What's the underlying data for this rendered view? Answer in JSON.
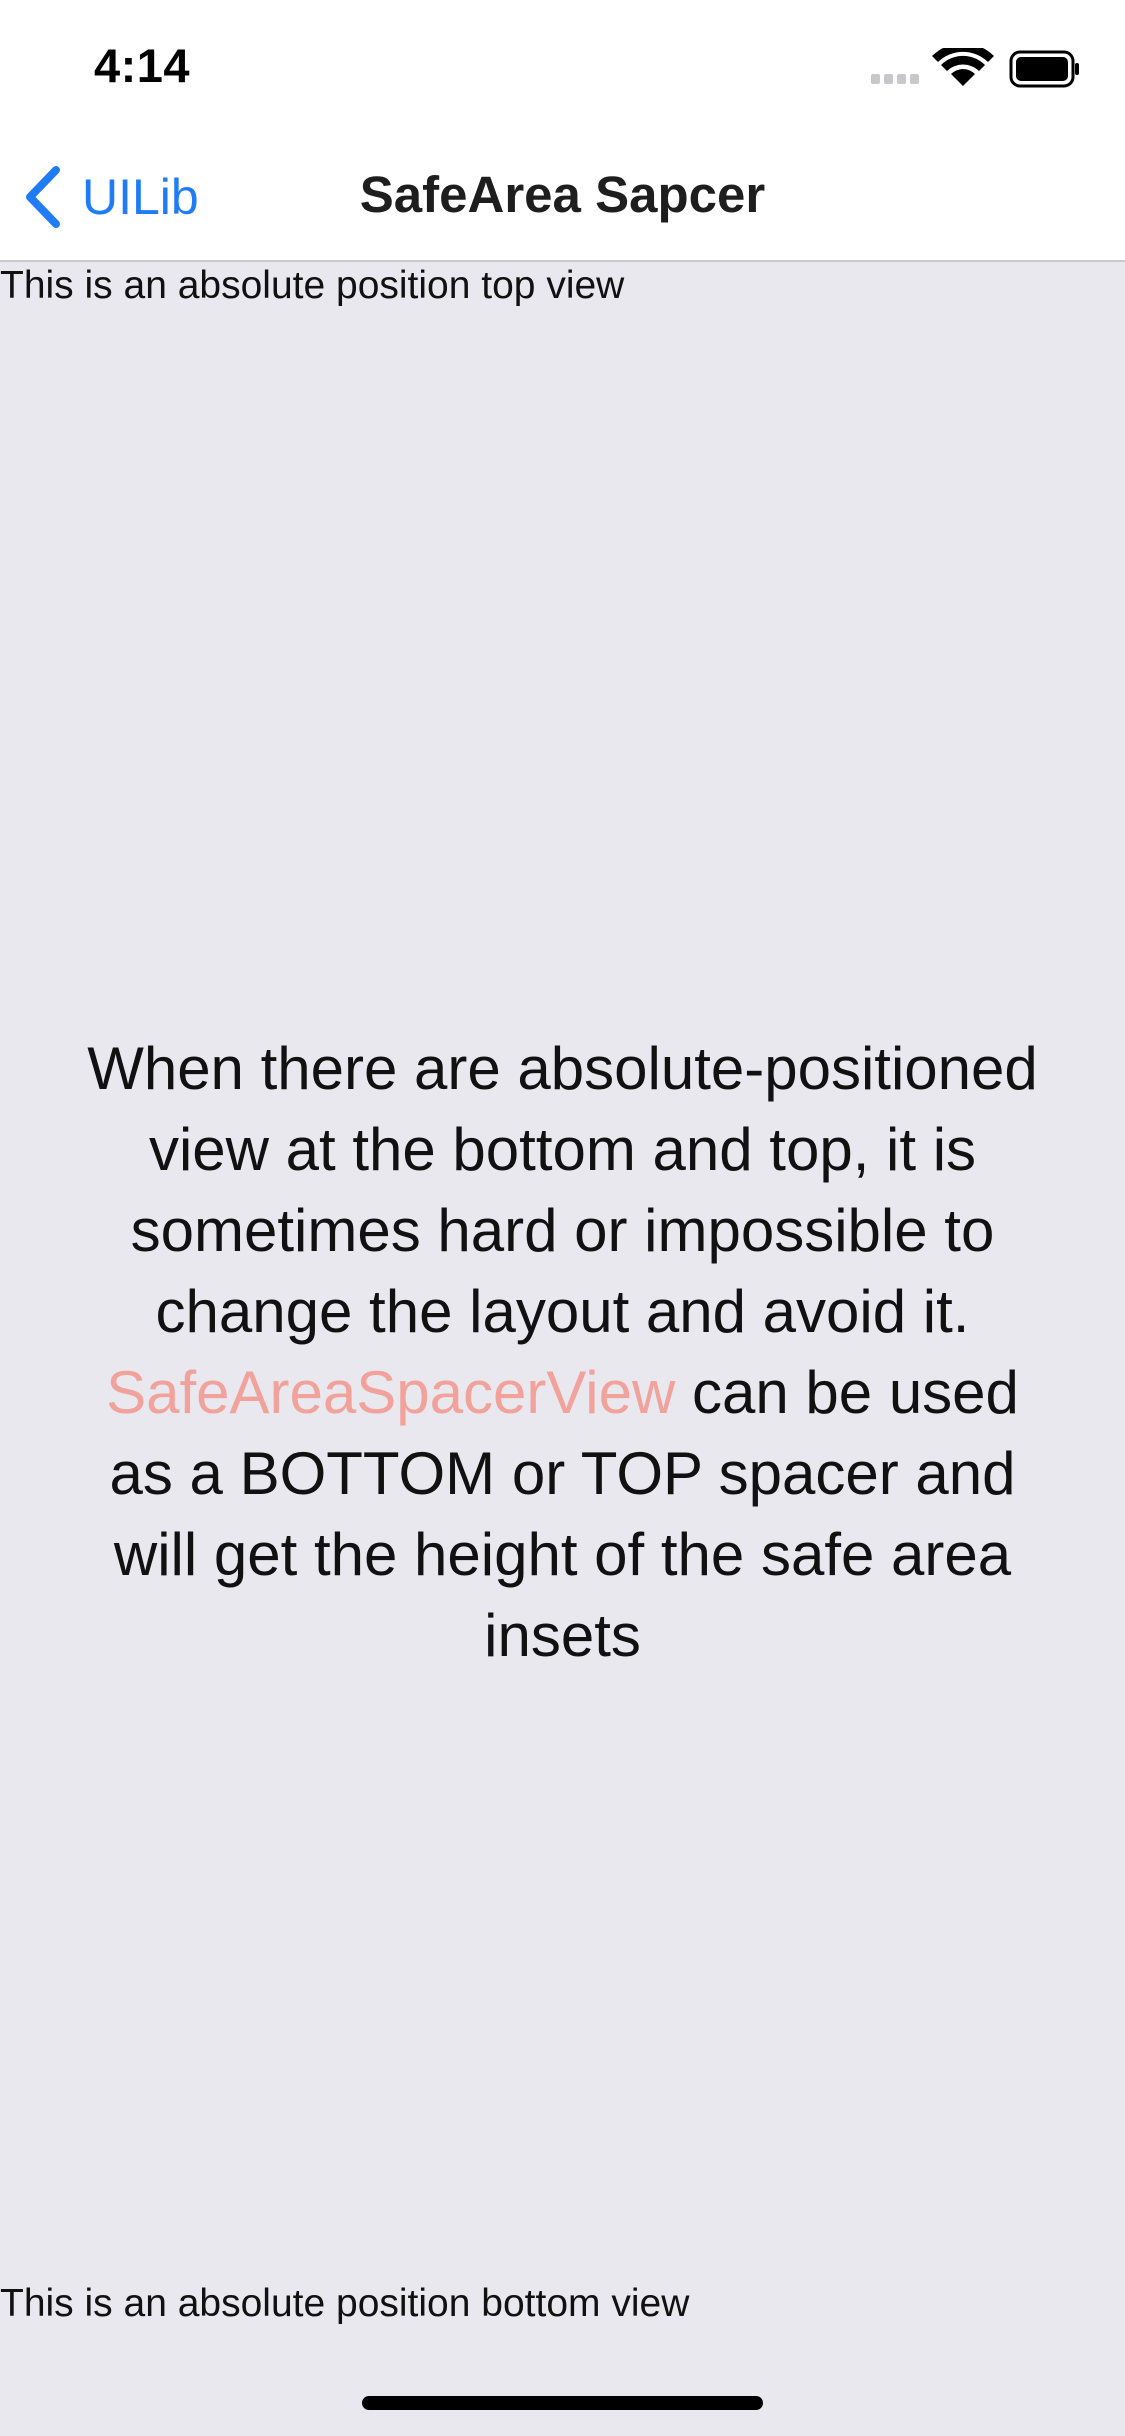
{
  "status_bar": {
    "time": "4:14",
    "icons": [
      "cellular-signal-icon",
      "wifi-icon",
      "battery-icon"
    ]
  },
  "nav_bar": {
    "back_label": "UILib",
    "title": "SafeArea Sapcer"
  },
  "content": {
    "top_view_text": "This is an absolute position top view",
    "explanation_before": "When there are absolute-positioned view at the bottom and top, it is sometimes hard or impossible to change the layout and avoid it. ",
    "explanation_highlight": "SafeAreaSpacerView",
    "explanation_after": " can be used as a BOTTOM or TOP spacer and will get the height of the safe area insets",
    "bottom_view_text": "This is an absolute position bottom view"
  },
  "colors": {
    "background": "#E9E8EF",
    "accent": "#1F7CF6",
    "highlight": "#F0A29B",
    "text": "#111111"
  }
}
